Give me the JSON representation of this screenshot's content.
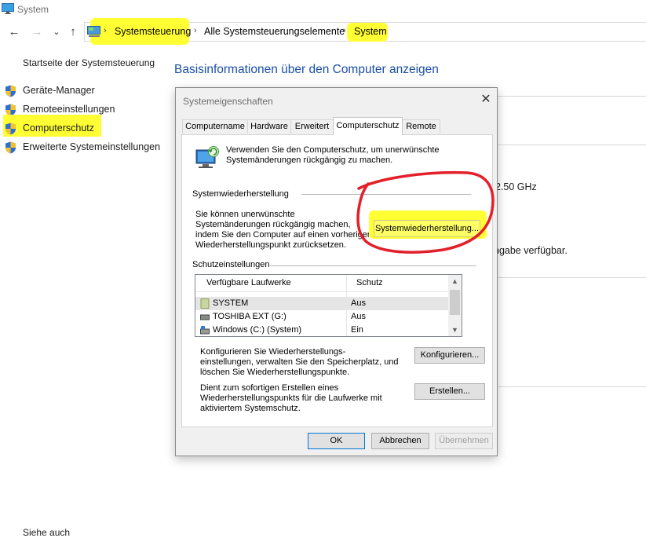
{
  "window": {
    "title": "System"
  },
  "nav": {
    "back": "←",
    "forward": "→",
    "recent": "⌄",
    "up": "↑",
    "breadcrumb": [
      "Systemsteuerung",
      "Alle Systemsteuerungselemente",
      "System"
    ],
    "separator": "›"
  },
  "sidebar": {
    "home": "Startseite der Systemsteuerung",
    "items": [
      {
        "label": "Geräte-Manager"
      },
      {
        "label": "Remoteeinstellungen"
      },
      {
        "label": "Computerschutz"
      },
      {
        "label": "Erweiterte Systemeinstellungen"
      }
    ],
    "see_also": "Siehe auch"
  },
  "main": {
    "title": "Basisinformationen über den Computer anzeigen",
    "fragment_cpu": "2.50 GHz",
    "fragment_pen": "ngabe verfügbar."
  },
  "dialog": {
    "title": "Systemeigenschaften",
    "close": "✕",
    "tabs": [
      "Computername",
      "Hardware",
      "Erweitert",
      "Computerschutz",
      "Remote"
    ],
    "active_tab": "Computerschutz",
    "intro_line1": "Verwenden Sie den Computerschutz, um unerwünschte",
    "intro_line2": "Systemänderungen rückgängig zu machen.",
    "restore_group": "Systemwiederherstellung",
    "restore_text": [
      "Sie können unerwünschte",
      "Systemänderungen rückgängig machen,",
      "indem Sie den Computer auf einen vorherigen",
      "Wiederherstellungspunkt zurücksetzen."
    ],
    "restore_button": "Systemwiederherstellung...",
    "protection_group": "Schutzeinstellungen",
    "list": {
      "columns": [
        "Verfügbare Laufwerke",
        "Schutz"
      ],
      "rows": [
        {
          "name": "SYSTEM",
          "state": "Aus"
        },
        {
          "name": "TOSHIBA EXT (G:)",
          "state": "Aus"
        },
        {
          "name": "Windows (C:) (System)",
          "state": "Ein"
        }
      ]
    },
    "configure_text": [
      "Konfigurieren Sie Wiederherstellungs-",
      "einstellungen, verwalten Sie den Speicherplatz, und",
      "löschen Sie Wiederherstellungspunkte."
    ],
    "configure_button": "Konfigurieren...",
    "create_text": [
      "Dient zum sofortigen Erstellen eines",
      "Wiederherstellungspunkts für die Laufwerke mit",
      "aktiviertem Systemschutz."
    ],
    "create_button": "Erstellen...",
    "ok": "OK",
    "cancel": "Abbrechen",
    "apply": "Übernehmen"
  },
  "colors": {
    "highlight": "#ffff33",
    "annotation": "#e3202a",
    "title_blue": "#1a4fa6"
  }
}
